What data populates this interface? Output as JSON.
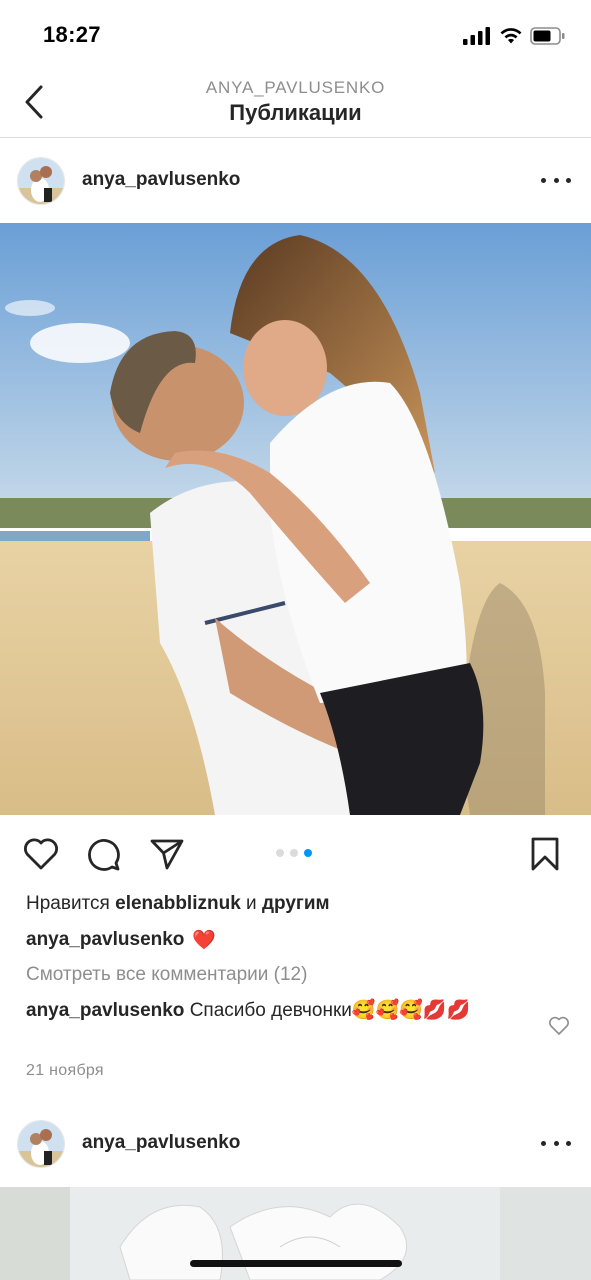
{
  "status_bar": {
    "time": "18:27"
  },
  "header": {
    "username": "ANYA_PAVLUSENKO",
    "title": "Публикации"
  },
  "posts": [
    {
      "username": "anya_pavlusenko",
      "carousel": {
        "count": 3,
        "active_index": 2
      },
      "likes": {
        "prefix": "Нравится",
        "user": "elenabbliznuk",
        "joiner": "и",
        "suffix": "другим"
      },
      "caption": {
        "user": "anya_pavlusenko",
        "text": "❤️"
      },
      "view_comments": "Смотреть все комментарии (12)",
      "comment": {
        "user": "anya_pavlusenko",
        "text": "Спасибо девчонки🥰🥰🥰💋💋"
      },
      "date": "21 ноября"
    },
    {
      "username": "anya_pavlusenko"
    }
  ],
  "colors": {
    "accent_blue": "#0095f6",
    "heart_red": "#e0262f",
    "text": "#262626",
    "muted": "#8e8e8e"
  },
  "icons": [
    "back-chevron-icon",
    "more-icon",
    "heart-icon",
    "comment-icon",
    "share-icon",
    "bookmark-icon"
  ]
}
